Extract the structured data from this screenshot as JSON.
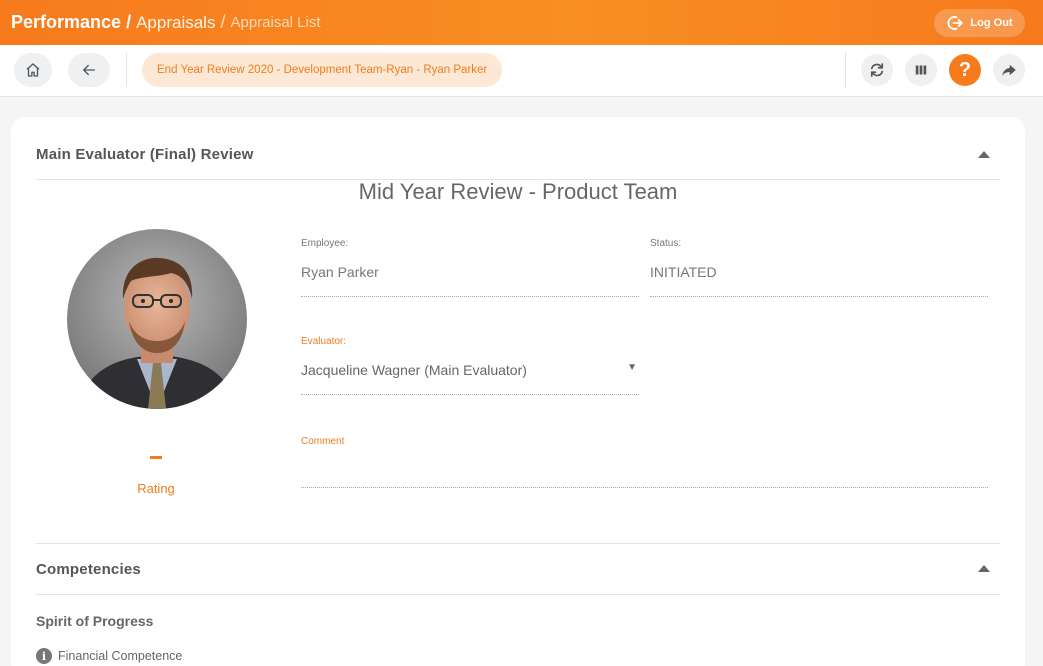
{
  "header": {
    "crumb_main": "Performance",
    "crumb_sep": "/",
    "crumb_mid": "Appraisals",
    "crumb_last": "Appraisal List",
    "logout_label": "Log Out"
  },
  "toolbar": {
    "record_pill": "End Year Review 2020 - Development Team-Ryan - Ryan Parker",
    "help_label": "?"
  },
  "evaluation": {
    "section_title": "Main Evaluator (Final) Review",
    "review_title": "Mid Year Review - Product Team",
    "rating_value": "-",
    "rating_label": "Rating",
    "employee_label": "Employee:",
    "employee_value": "Ryan Parker",
    "status_label": "Status:",
    "status_value": "INITIATED",
    "evaluator_label": "Evaluator:",
    "evaluator_value": "Jacqueline Wagner (Main Evaluator)",
    "comment_label": "Comment",
    "comment_value": ""
  },
  "competencies": {
    "section_title": "Competencies",
    "group_title": "Spirit of Progress",
    "items": [
      {
        "label": "Financial Competence"
      }
    ]
  },
  "colors": {
    "accent": "#f77a1c",
    "accent_light": "#fde8d5"
  }
}
